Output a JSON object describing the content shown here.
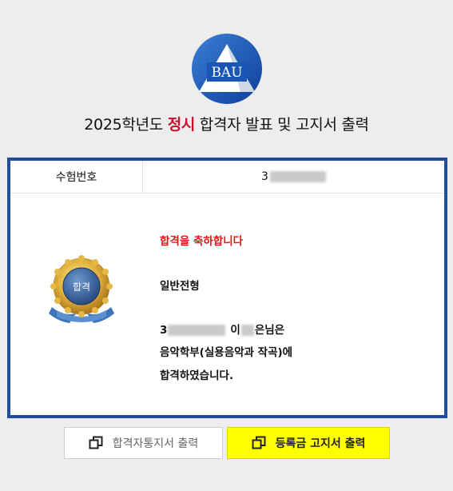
{
  "header": {
    "logo_text": "BAU",
    "title_prefix": "2025학년도 ",
    "title_highlight": "정시",
    "title_suffix": " 합격자 발표 및 고지서 출력"
  },
  "result": {
    "exam_number_label": "수험번호",
    "exam_number_value": "3",
    "badge_text": "합격",
    "congrats": "합격을 축하합니다",
    "admission_type": "일반전형",
    "line1_prefix": "3",
    "line1_name_part": "이",
    "line1_suffix": "은님은",
    "line2": "음악학부(실용음악과 작곡)에",
    "line3": "합격하였습니다."
  },
  "buttons": {
    "notice_label": "합격자통지서 출력",
    "tuition_label": "등록금 고지서 출력"
  },
  "colors": {
    "brand_blue": "#1f4f9b",
    "highlight_red": "#c8102e",
    "congrats_red": "#e31414",
    "button_yellow": "#ffff00"
  }
}
